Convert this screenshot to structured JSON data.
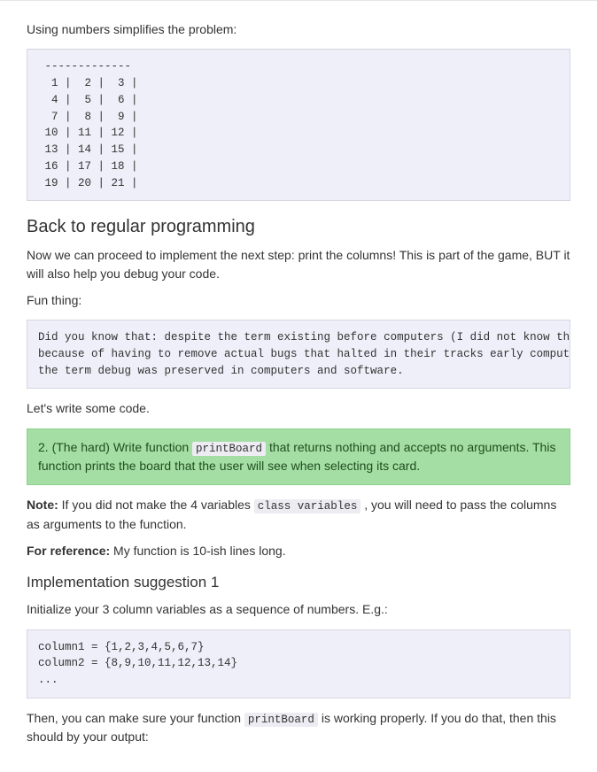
{
  "intro_text": "Using numbers simplifies the problem:",
  "code_grid": " -------------\n  1 |  2 |  3 |\n  4 |  5 |  6 |\n  7 |  8 |  9 |\n 10 | 11 | 12 |\n 13 | 14 | 15 |\n 16 | 17 | 18 |\n 19 | 20 | 21 |",
  "heading_back": "Back to regular programming",
  "para_proceed": "Now we can proceed to implement the next step: print the columns! This is part of the game, BUT it will also help you debug your code.",
  "fun_label": "Fun thing:",
  "fun_code": "Did you know that: despite the term existing before computers (I did not know this!),\nbecause of having to remove actual bugs that halted in their tracks early computers,\nthe term debug was preserved in computers and software.",
  "lets_write": "Let's write some code.",
  "task": {
    "before": "2. (The hard) Write function ",
    "code": "printBoard",
    "after": " that returns nothing and accepts no arguments. This function prints the board that the user will see when selecting its card."
  },
  "note": {
    "label": "Note:",
    "before": " If you did not make the 4 variables ",
    "code": "class variables",
    "after": " , you will need to pass the columns as arguments to the function."
  },
  "reference": {
    "label": "For reference:",
    "text": " My function is 10-ish lines long."
  },
  "heading_impl": "Implementation suggestion 1",
  "impl_intro": "Initialize your 3 column variables as a sequence of numbers. E.g.:",
  "code_columns": "column1 = {1,2,3,4,5,6,7}\ncolumn2 = {8,9,10,11,12,13,14}\n...",
  "closing": {
    "before": "Then, you can make sure your function ",
    "code": "printBoard",
    "after": " is working properly. If you do that, then this should by your output:"
  }
}
